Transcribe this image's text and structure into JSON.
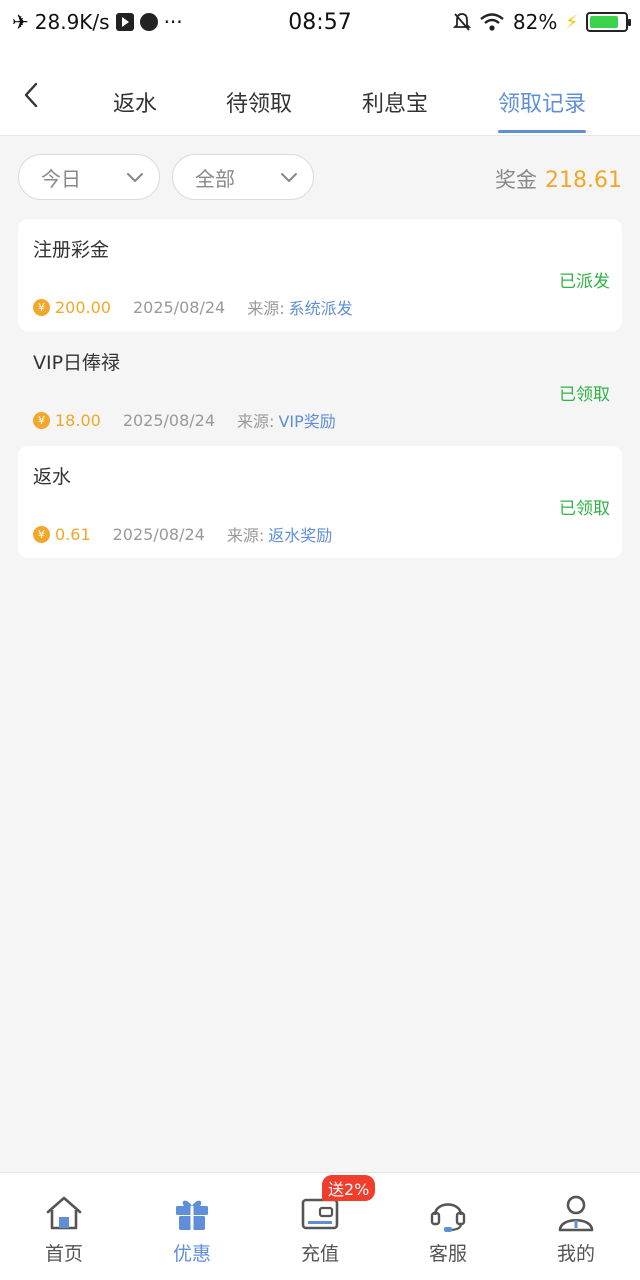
{
  "status_bar": {
    "net_speed": "28.9K/s",
    "time": "08:57",
    "battery": "82%",
    "battery_level": 0.82
  },
  "tabs": [
    {
      "label": "返水",
      "active": false
    },
    {
      "label": "待领取",
      "active": false
    },
    {
      "label": "利息宝",
      "active": false
    },
    {
      "label": "领取记录",
      "active": true
    }
  ],
  "filters": {
    "date": "今日",
    "type": "全部"
  },
  "bonus": {
    "label": "奖金",
    "value": "218.61"
  },
  "records": [
    {
      "title": "注册彩金",
      "status": "已派发",
      "amount": "200.00",
      "date": "2025/08/24",
      "source_label": "来源:",
      "source": "系统派发"
    },
    {
      "title": "VIP日俸禄",
      "status": "已领取",
      "amount": "18.00",
      "date": "2025/08/24",
      "source_label": "来源:",
      "source": "VIP奖励"
    },
    {
      "title": "返水",
      "status": "已领取",
      "amount": "0.61",
      "date": "2025/08/24",
      "source_label": "来源:",
      "source": "返水奖励"
    }
  ],
  "bottom_nav": [
    {
      "label": "首页",
      "icon": "home-icon",
      "active": false
    },
    {
      "label": "优惠",
      "icon": "gift-icon",
      "active": true
    },
    {
      "label": "充值",
      "icon": "wallet-icon",
      "active": false,
      "badge": "送2%"
    },
    {
      "label": "客服",
      "icon": "headset-icon",
      "active": false
    },
    {
      "label": "我的",
      "icon": "user-icon",
      "active": false
    }
  ],
  "colors": {
    "accent": "#5f8fd8",
    "gold": "#f1a72a",
    "success": "#2fb344",
    "badge": "#f23c2c"
  }
}
